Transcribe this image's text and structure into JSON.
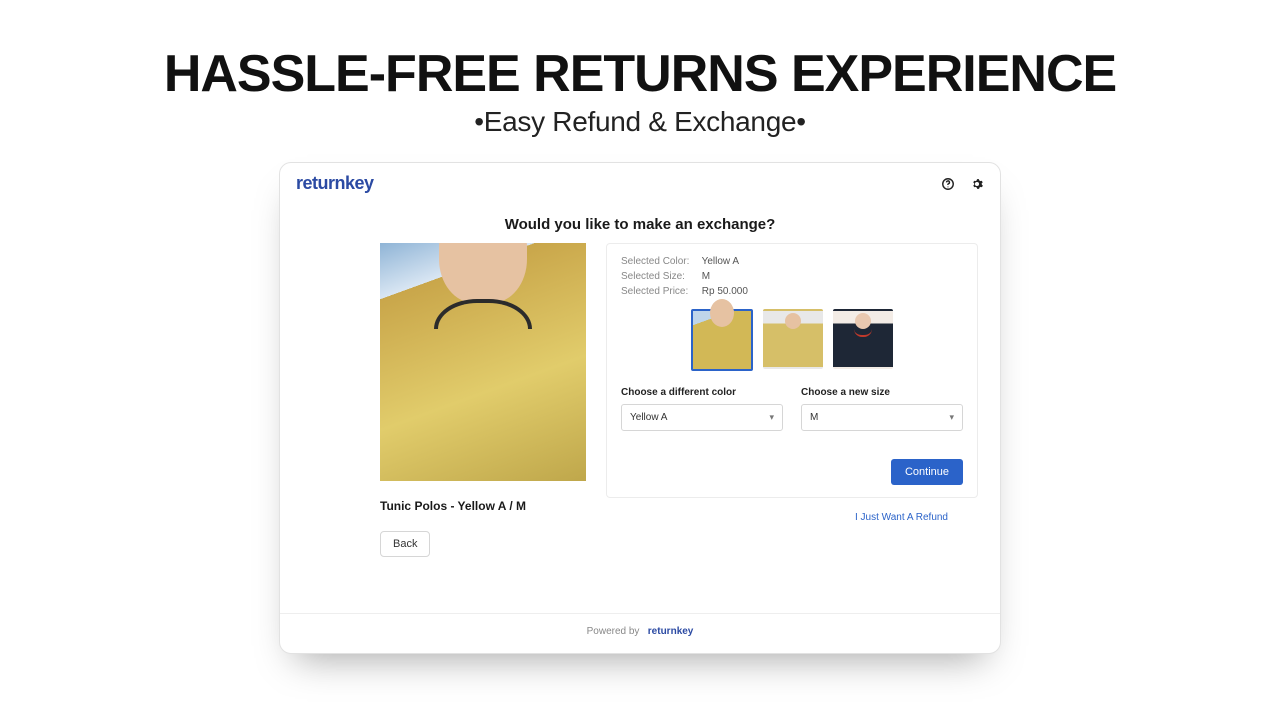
{
  "hero": {
    "title": "HASSLE-FREE RETURNS EXPERIENCE",
    "subtitle": "•Easy Refund & Exchange•"
  },
  "brand": {
    "part1": "return",
    "part2": "key"
  },
  "page": {
    "heading": "Would you like to make an exchange?",
    "product_title": "Tunic Polos - Yellow A / M",
    "back_label": "Back"
  },
  "meta": {
    "color_label": "Selected Color:",
    "color_value": "Yellow A",
    "size_label": "Selected Size:",
    "size_value": "M",
    "price_label": "Selected Price:",
    "price_value": "Rp 50.000"
  },
  "selectors": {
    "color_label": "Choose a different color",
    "color_value": "Yellow A",
    "size_label": "Choose a new size",
    "size_value": "M"
  },
  "actions": {
    "continue": "Continue",
    "refund_link": "I Just Want A Refund"
  },
  "footer": {
    "powered": "Powered by",
    "brand1": "return",
    "brand2": "key"
  }
}
